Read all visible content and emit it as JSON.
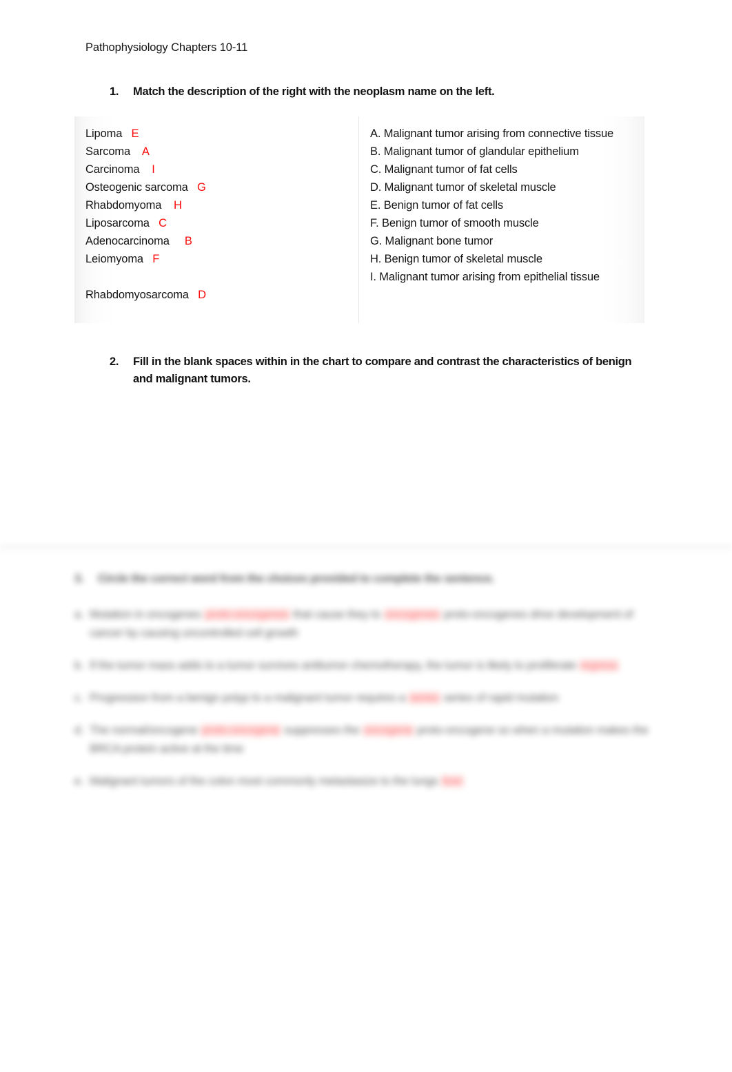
{
  "document": {
    "header": "Pathophysiology Chapters 10-11",
    "accent_red": "#FB0A0A",
    "text_color": "#151515",
    "page_background": "#FFFFFF"
  },
  "questions": [
    {
      "number": "1.",
      "text": "Match the description of the right with the neoplasm name on the left."
    },
    {
      "number": "2.",
      "text": "Fill in the blank spaces within in the chart to compare and contrast the characteristics of benign and malignant tumors."
    },
    {
      "number": "3.",
      "text": "Circle the correct word from the choices provided to complete the sentence."
    }
  ],
  "match_table": {
    "neoplasms": [
      {
        "name": "Lipoma",
        "answer": "E"
      },
      {
        "name": "Sarcoma",
        "answer": "A"
      },
      {
        "name": "Carcinoma",
        "answer": "I"
      },
      {
        "name": "Osteogenic sarcoma",
        "answer": "G"
      },
      {
        "name": "Rhabdomyoma",
        "answer": "H"
      },
      {
        "name": "Liposarcoma",
        "answer": "C"
      },
      {
        "name": "Adenocarcinoma",
        "answer": "B"
      },
      {
        "name": "Leiomyoma",
        "answer": "F"
      },
      {
        "name": "",
        "answer": ""
      },
      {
        "name": "Rhabdomyosarcoma",
        "answer": "D"
      }
    ],
    "descriptions": [
      "A. Malignant tumor arising from connective tissue",
      "B. Malignant tumor of glandular epithelium",
      "C. Malignant tumor of fat cells",
      "D. Malignant tumor of skeletal muscle",
      "E. Benign tumor of fat cells",
      "F. Benign tumor of smooth muscle",
      "G. Malignant bone tumor",
      "H. Benign tumor of skeletal muscle",
      "I. Malignant tumor arising from epithelial tissue"
    ]
  },
  "obscured_section": {
    "note": "Lower portion of the page is blurred/obscured and unreadable.",
    "paragraphs": [
      {
        "label": "a.",
        "parts": [
          {
            "type": "text",
            "value": "Mutation in oncogenes"
          },
          {
            "type": "red",
            "value": "proto-oncogenes"
          },
          {
            "type": "text",
            "value": "that cause they to"
          },
          {
            "type": "red",
            "value": "oncogenes"
          },
          {
            "type": "text",
            "value": "proto-oncogenes drive development of cancer by causing uncontrolled cell growth"
          }
        ]
      },
      {
        "label": "b.",
        "parts": [
          {
            "type": "text",
            "value": "If the tumor mass adds to a tumor survives antitumor chemotherapy, the tumor is likely to"
          },
          {
            "type": "text",
            "value": "proliferate"
          },
          {
            "type": "red",
            "value": "regress"
          }
        ]
      },
      {
        "label": "c.",
        "parts": [
          {
            "type": "text",
            "value": "Progression from a benign polyp to a malignant tumor requires a"
          },
          {
            "type": "red",
            "value": "series"
          },
          {
            "type": "text",
            "value": "series of rapid mutation"
          }
        ]
      },
      {
        "label": "d.",
        "parts": [
          {
            "type": "text",
            "value": "The normal/oncogene"
          },
          {
            "type": "red",
            "value": "proto-oncogene"
          },
          {
            "type": "text",
            "value": "suppresses the"
          },
          {
            "type": "red",
            "value": "oncogene"
          },
          {
            "type": "text",
            "value": "proto-oncogene so when a mutation makes the BRCA protein active at the time"
          }
        ]
      },
      {
        "label": "e.",
        "parts": [
          {
            "type": "text",
            "value": "Malignant tumors of the colon most commonly metastasize to the lungs"
          },
          {
            "type": "red",
            "value": "liver"
          }
        ]
      }
    ]
  }
}
